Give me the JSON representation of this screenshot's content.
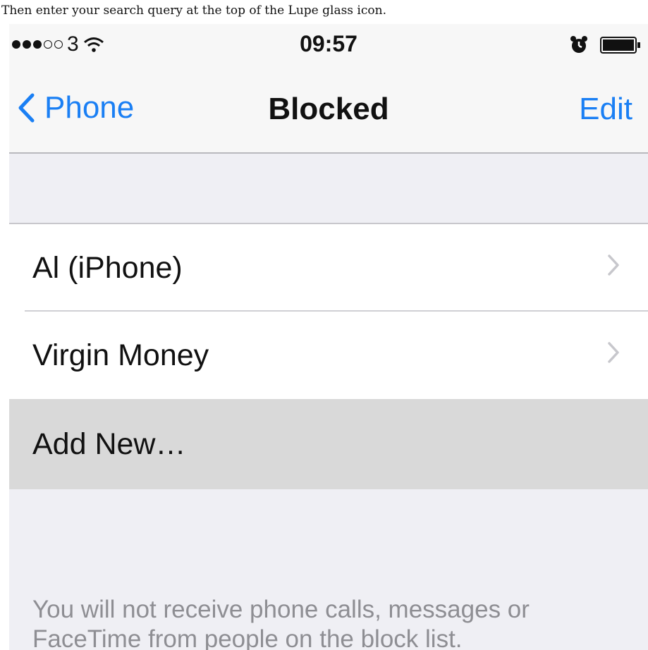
{
  "caption": "Then enter your search query at the top of the Lupe glass icon.",
  "status_bar": {
    "carrier": "3",
    "time": "09:57",
    "signal_full": 3,
    "signal_total": 5
  },
  "nav": {
    "back_label": "Phone",
    "title": "Blocked",
    "edit_label": "Edit"
  },
  "blocked_list": [
    {
      "label": "Al (iPhone)"
    },
    {
      "label": "Virgin Money"
    }
  ],
  "add_new_label": "Add New…",
  "footer_text": "You will not receive phone calls, messages or FaceTime from people on the block list.",
  "colors": {
    "accent": "#1a7ff4",
    "background": "#efeff4",
    "highlight_row": "#d9d9d9",
    "footer_text": "#8e8e93"
  }
}
